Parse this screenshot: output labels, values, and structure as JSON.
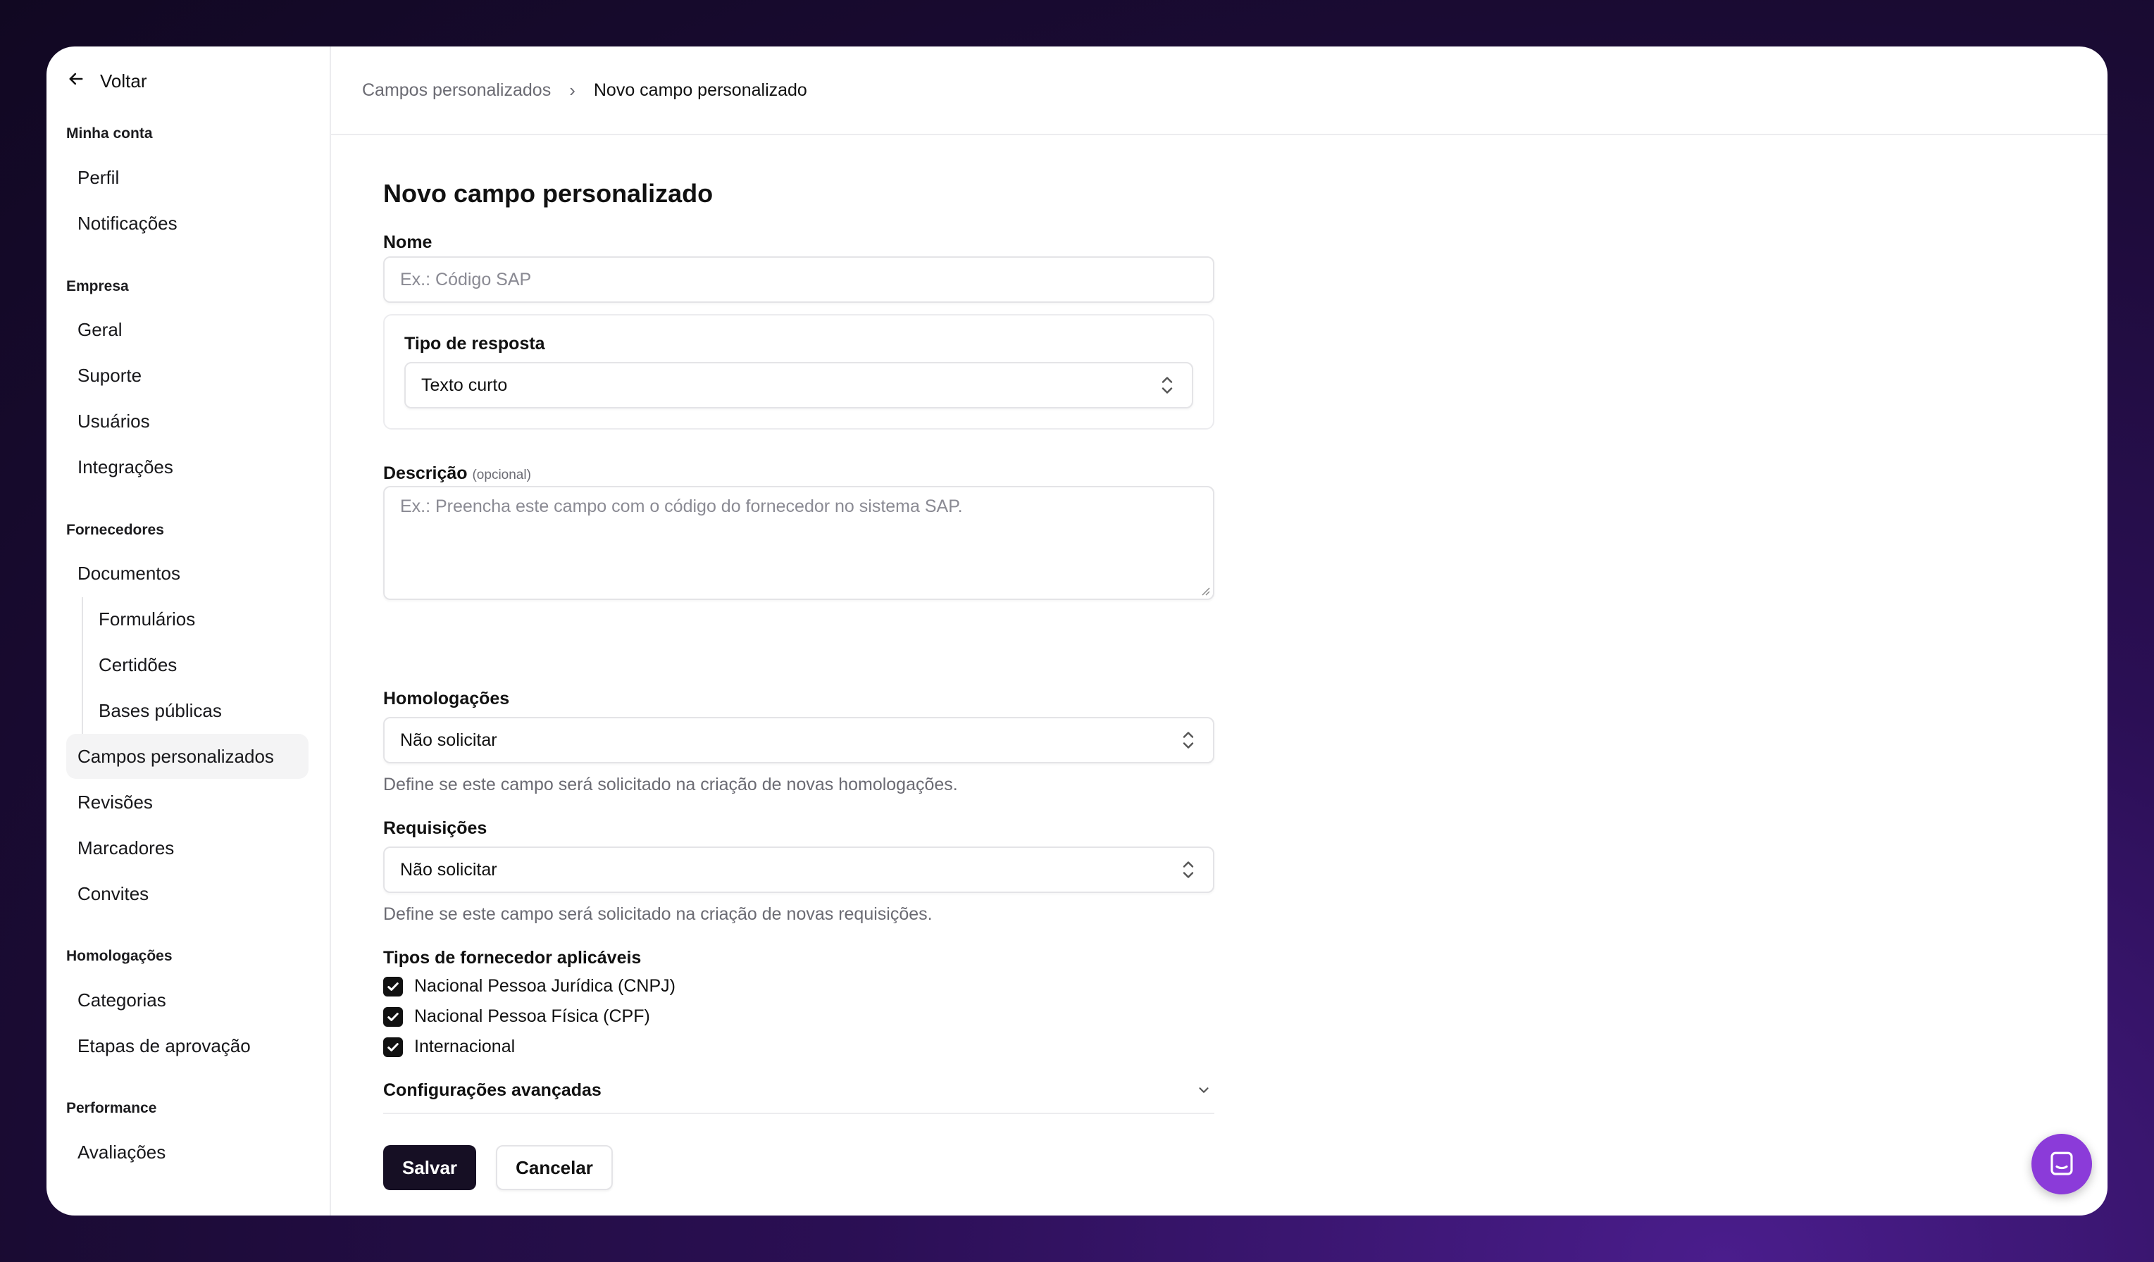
{
  "sidebar": {
    "back_label": "Voltar",
    "sections": {
      "minha_conta": {
        "title": "Minha conta",
        "items": [
          "Perfil",
          "Notificações"
        ]
      },
      "empresa": {
        "title": "Empresa",
        "items": [
          "Geral",
          "Suporte",
          "Usuários",
          "Integrações"
        ]
      },
      "fornecedores": {
        "title": "Fornecedores",
        "items": [
          "Documentos",
          "Formulários",
          "Certidões",
          "Bases públicas",
          "Campos personalizados",
          "Revisões",
          "Marcadores",
          "Convites"
        ]
      },
      "homologacoes": {
        "title": "Homologações",
        "items": [
          "Categorias",
          "Etapas de aprovação"
        ]
      },
      "performance": {
        "title": "Performance",
        "items": [
          "Avaliações"
        ]
      }
    },
    "active_item": "Campos personalizados"
  },
  "breadcrumb": {
    "parent": "Campos personalizados",
    "separator": "›",
    "current": "Novo campo personalizado"
  },
  "form": {
    "title": "Novo campo personalizado",
    "nome": {
      "label": "Nome",
      "placeholder": "Ex.: Código SAP",
      "value": ""
    },
    "tipo_resposta": {
      "label": "Tipo de resposta",
      "value": "Texto curto"
    },
    "descricao": {
      "label": "Descrição",
      "optional": "(opcional)",
      "placeholder": "Ex.: Preencha este campo com o código do fornecedor no sistema SAP."
    },
    "homologacoes": {
      "label": "Homologações",
      "value": "Não solicitar",
      "helper": "Define se este campo será solicitado na criação de novas homologações."
    },
    "requisicoes": {
      "label": "Requisições",
      "value": "Não solicitar",
      "helper": "Define se este campo será solicitado na criação de novas requisições."
    },
    "tipos_fornecedor": {
      "label": "Tipos de fornecedor aplicáveis",
      "options": [
        {
          "label": "Nacional Pessoa Jurídica (CNPJ)",
          "checked": true
        },
        {
          "label": "Nacional Pessoa Física (CPF)",
          "checked": true
        },
        {
          "label": "Internacional",
          "checked": true
        }
      ]
    },
    "advanced": {
      "label": "Configurações avançadas",
      "expanded": false
    },
    "save_label": "Salvar",
    "cancel_label": "Cancelar"
  },
  "colors": {
    "primary_button": "#160f24",
    "chat_launcher": "#8b3bd9",
    "background": "#1a0b33"
  },
  "icons": {
    "back": "arrow-left-icon",
    "breadcrumb_separator": "chevron-right-icon",
    "select": "chevron-up-down-icon",
    "checkbox": "check-icon",
    "accordion": "chevron-down-icon",
    "chat": "chat-bubble-icon"
  }
}
